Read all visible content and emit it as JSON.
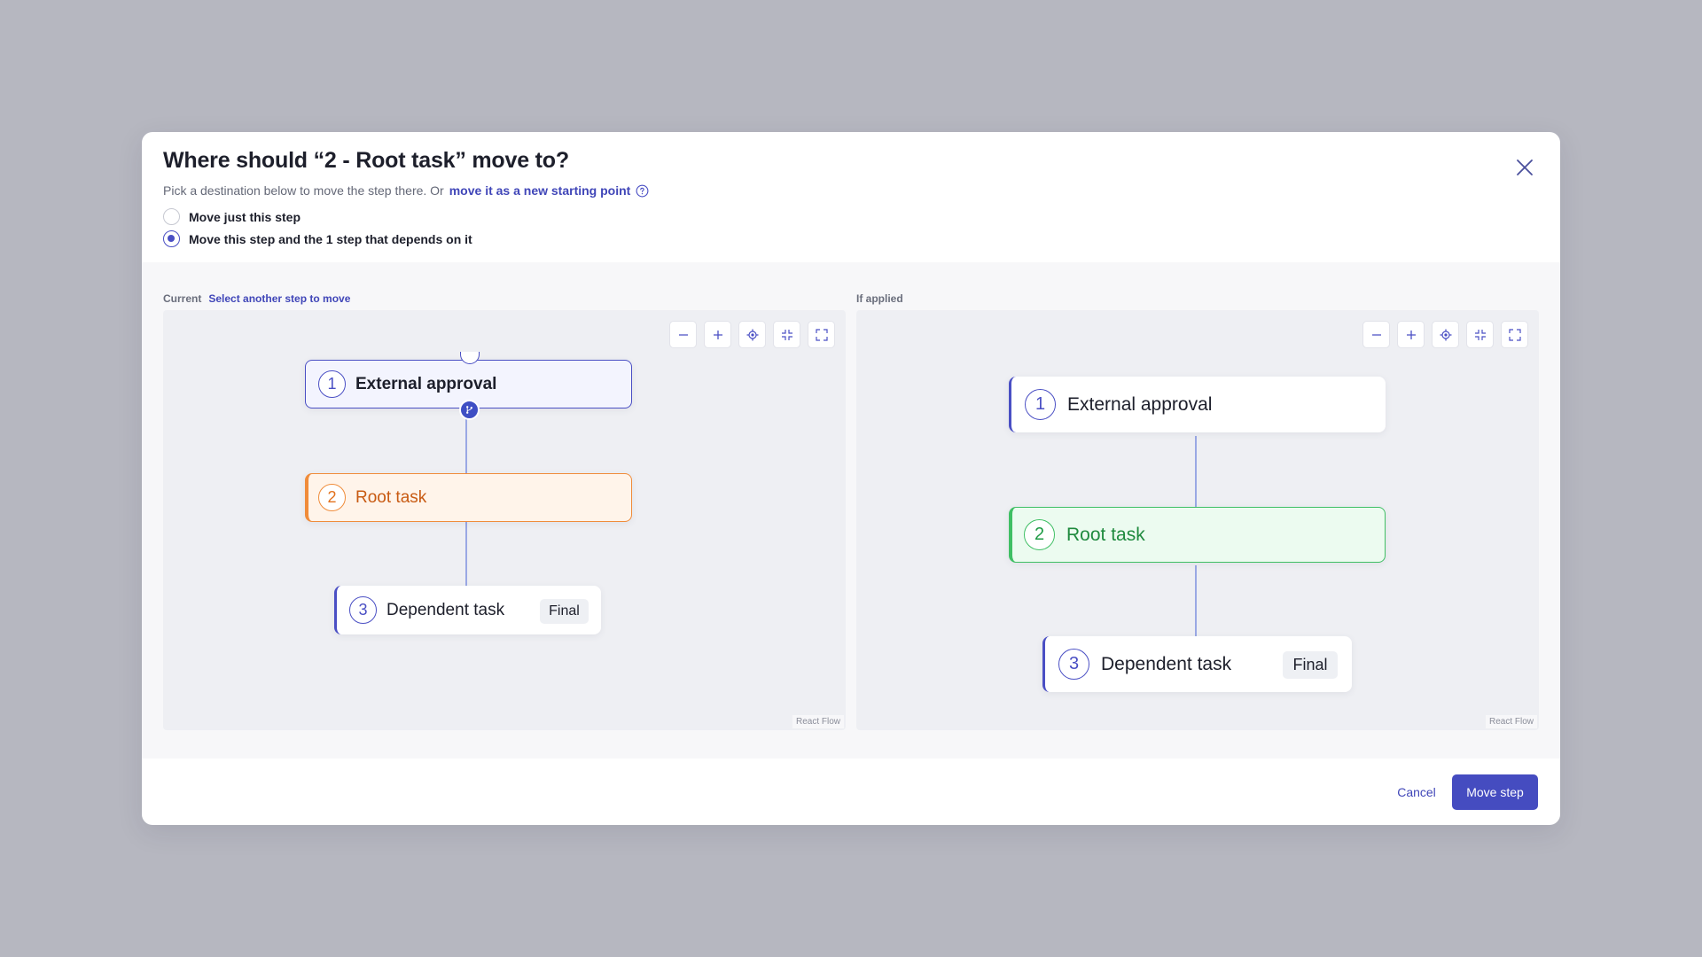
{
  "modal": {
    "title": "Where should “2 - Root task” move to?",
    "subtitle_text": "Pick a destination below to move the step there. Or",
    "subtitle_link": "move it as a new starting point",
    "options": [
      {
        "label": "Move just this step",
        "checked": false
      },
      {
        "label": "Move this step and the 1 step that depends on it",
        "checked": true
      }
    ]
  },
  "current": {
    "label": "Current",
    "link": "Select another step to move",
    "watermark": "React Flow",
    "nodes": [
      {
        "number": "1",
        "title": "External approval"
      },
      {
        "number": "2",
        "title": "Root task"
      },
      {
        "number": "3",
        "title": "Dependent task",
        "badge": "Final"
      }
    ]
  },
  "applied": {
    "label": "If applied",
    "watermark": "React Flow",
    "nodes": [
      {
        "number": "1",
        "title": "External approval"
      },
      {
        "number": "2",
        "title": "Root task"
      },
      {
        "number": "3",
        "title": "Dependent task",
        "badge": "Final"
      }
    ]
  },
  "footer": {
    "cancel_label": "Cancel",
    "submit_label": "Move step"
  },
  "colors": {
    "accent": "#4a4fc4",
    "moving": "#f08c3a",
    "target": "#3fbf64",
    "primary_button": "#454cc0"
  },
  "icons": {
    "close": "close-icon",
    "help": "help-circle-icon",
    "zoom_out": "minus-icon",
    "zoom_in": "plus-icon",
    "fit": "target-icon",
    "shrink": "collapse-icon",
    "fullscreen": "fullscreen-icon",
    "branch": "branch-icon"
  }
}
